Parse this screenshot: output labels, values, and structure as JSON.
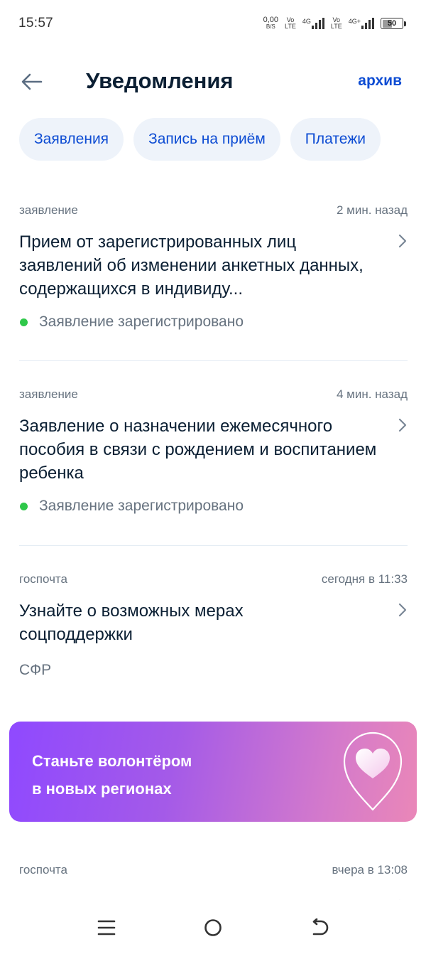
{
  "status_bar": {
    "time": "15:57",
    "speed_value": "0,00",
    "speed_unit": "B/S",
    "volte_top": "Vo",
    "volte_bottom": "LTE",
    "network1": "4G",
    "network2": "4G+",
    "battery_level": "50"
  },
  "header": {
    "title": "Уведомления",
    "archive_label": "архив"
  },
  "filters": [
    "Заявления",
    "Запись на приём",
    "Платежи"
  ],
  "notifications": [
    {
      "category": "заявление",
      "time": "2 мин. назад",
      "title": "Прием от зарегистрированных лиц заявлений об изменении анкетных данных, содержащихся в индивиду...",
      "status": "Заявление зарегистрировано"
    },
    {
      "category": "заявление",
      "time": "4 мин. назад",
      "title": "Заявление о назначении ежемесячного пособия в связи с рождением и воспитанием ребенка",
      "status": "Заявление зарегистрировано"
    },
    {
      "category": "госпочта",
      "time": "сегодня в 11:33",
      "title": "Узнайте о возможных мерах соцподдержки",
      "source": "СФР"
    },
    {
      "category": "госпочта",
      "time": "вчера в 13:08"
    }
  ],
  "banner": {
    "line1": "Станьте волонтёром",
    "line2": "в новых регионах"
  },
  "colors": {
    "accent": "#0d4cd3",
    "status_ok": "#2fc84a",
    "chip_bg": "#eef3fa",
    "banner_start": "#8f49ff",
    "banner_end": "#ea87b8"
  },
  "icons": {
    "back": "arrow-left-icon",
    "chevron": "chevron-right-icon",
    "banner": "heart-location-pin-icon",
    "nav_menu": "menu-icon",
    "nav_home": "home-circle-icon",
    "nav_back": "back-gesture-icon"
  }
}
